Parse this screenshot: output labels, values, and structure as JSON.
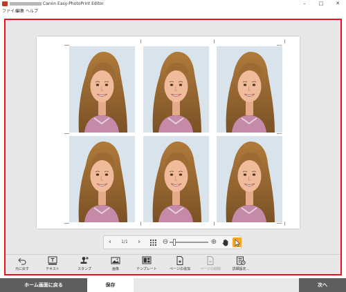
{
  "window": {
    "title": "Canon Easy-PhotoPrint Editor",
    "minimize": "–",
    "maximize": "□",
    "close": "✕"
  },
  "menu": [
    "ファイル",
    "編集",
    "ヘルプ"
  ],
  "canvas": {
    "photo_count": 6,
    "photos": [
      {
        "label": "girl-portrait"
      },
      {
        "label": "girl-portrait"
      },
      {
        "label": "girl-portrait"
      },
      {
        "label": "girl-portrait"
      },
      {
        "label": "girl-portrait"
      },
      {
        "label": "girl-portrait"
      }
    ]
  },
  "zoom_toolbar": {
    "prev": "‹",
    "page_indicator": "1/1",
    "next": "›",
    "zoom_out": "⊖",
    "zoom_in": "⊕",
    "zoom_level_fraction": 0.1
  },
  "tools": [
    {
      "label": "元に戻す",
      "icon": "undo-icon",
      "enabled": true
    },
    {
      "label": "テキスト",
      "icon": "text-icon",
      "enabled": true
    },
    {
      "label": "スタンプ",
      "icon": "stamp-icon",
      "enabled": true
    },
    {
      "label": "画像",
      "icon": "image-icon",
      "enabled": true
    },
    {
      "label": "テンプレート",
      "icon": "template-icon",
      "enabled": true
    },
    {
      "label": "ページの追加",
      "icon": "add-page-icon",
      "enabled": true
    },
    {
      "label": "ページの削除",
      "icon": "delete-page-icon",
      "enabled": false
    },
    {
      "label": "詳細設定...",
      "icon": "advanced-settings-icon",
      "enabled": true
    }
  ],
  "bottom": {
    "home": "ホーム画面に戻る",
    "save": "保存",
    "next": "次へ"
  },
  "colors": {
    "selection_border": "#e8141b",
    "cursor_button": "#f5a623",
    "bottom_button": "#5e5e5e"
  }
}
